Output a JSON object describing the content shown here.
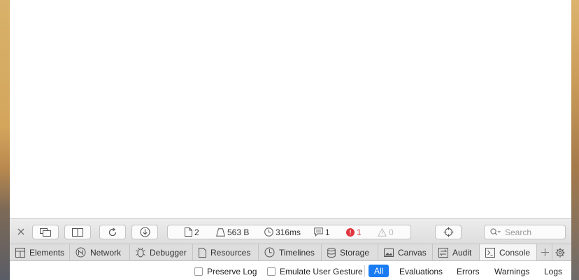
{
  "toolbar": {
    "close_icon": "close-icon",
    "stats": {
      "resources": "2",
      "size": "563 B",
      "time": "316ms",
      "logs": "1",
      "errors": "1",
      "warnings": "0",
      "error_badge": "!"
    },
    "search_placeholder": "Search"
  },
  "tabs": [
    {
      "label": "Elements",
      "icon": "elements-icon"
    },
    {
      "label": "Network",
      "icon": "network-icon"
    },
    {
      "label": "Debugger",
      "icon": "debugger-icon"
    },
    {
      "label": "Resources",
      "icon": "resources-icon"
    },
    {
      "label": "Timelines",
      "icon": "timelines-icon"
    },
    {
      "label": "Storage",
      "icon": "storage-icon"
    },
    {
      "label": "Canvas",
      "icon": "canvas-icon"
    },
    {
      "label": "Audit",
      "icon": "audit-icon"
    },
    {
      "label": "Console",
      "icon": "console-icon",
      "active": true
    }
  ],
  "filterbar": {
    "preserve_log": "Preserve Log",
    "emulate_gesture": "Emulate User Gesture",
    "filters": [
      "All",
      "Evaluations",
      "Errors",
      "Warnings",
      "Logs"
    ],
    "active_filter": "All"
  },
  "colors": {
    "accent": "#1a7cf3",
    "error": "#e0353d",
    "toolbar_bg": "#e4e4e4"
  }
}
